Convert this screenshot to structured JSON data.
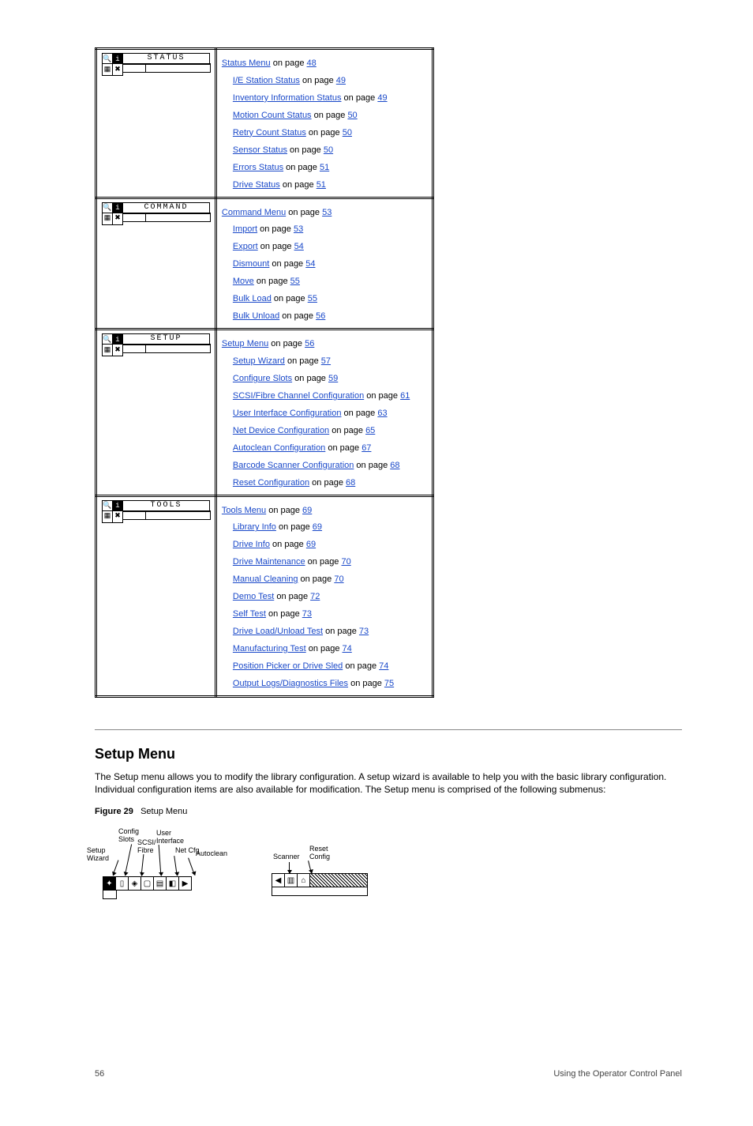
{
  "menu_table": [
    {
      "panel_title": "STATUS",
      "heading": {
        "label": "Status Menu",
        "page": "48"
      },
      "items": [
        {
          "label": "I/E Station Status",
          "page": "49"
        },
        {
          "label": "Inventory Information Status",
          "page": "49"
        },
        {
          "label": "Motion Count Status",
          "page": "50"
        },
        {
          "label": "Retry Count Status",
          "page": "50"
        },
        {
          "label": "Sensor Status",
          "page": "50"
        },
        {
          "label": "Errors Status",
          "page": "51"
        },
        {
          "label": "Drive Status",
          "page": "51"
        }
      ]
    },
    {
      "panel_title": "COMMAND",
      "heading": {
        "label": "Command Menu",
        "page": "53"
      },
      "items": [
        {
          "label": "Import",
          "page": "53"
        },
        {
          "label": "Export",
          "page": "54"
        },
        {
          "label": "Dismount",
          "page": "54"
        },
        {
          "label": "Move",
          "page": "55"
        },
        {
          "label": "Bulk Load",
          "page": "55"
        },
        {
          "label": "Bulk Unload",
          "page": "56"
        }
      ]
    },
    {
      "panel_title": "SETUP",
      "heading": {
        "label": "Setup Menu",
        "page": "56"
      },
      "items": [
        {
          "label": "Setup Wizard",
          "page": "57"
        },
        {
          "label": "Configure Slots",
          "page": "59"
        },
        {
          "label": "SCSI/Fibre Channel Configuration",
          "page": "61"
        },
        {
          "label": "User Interface Configuration",
          "page": "63"
        },
        {
          "label": "Net Device Configuration",
          "page": "65"
        },
        {
          "label": "Autoclean Configuration",
          "page": "67"
        },
        {
          "label": "Barcode Scanner Configuration",
          "page": "68"
        },
        {
          "label": "Reset Configuration",
          "page": "68"
        }
      ]
    },
    {
      "panel_title": "TOOLS",
      "heading": {
        "label": "Tools Menu",
        "page": "69"
      },
      "items": [
        {
          "label": "Library Info",
          "page": "69"
        },
        {
          "label": "Drive Info",
          "page": "69"
        },
        {
          "label": "Drive Maintenance",
          "page": "70"
        },
        {
          "label": "Manual Cleaning",
          "page": "70"
        },
        {
          "label": "Demo Test",
          "page": "72"
        },
        {
          "label": "Self Test",
          "page": "73"
        },
        {
          "label": "Drive Load/Unload Test",
          "page": "73"
        },
        {
          "label": "Manufacturing Test",
          "page": "74"
        },
        {
          "label": "Position Picker or Drive Sled",
          "page": "74"
        },
        {
          "label": "Output Logs/Diagnostics Files",
          "page": "75"
        }
      ]
    }
  ],
  "setup_section": {
    "title": "Setup Menu",
    "body": "The Setup menu allows you to modify the library configuration. A setup wizard is available to help you with the basic library configuration. Individual configuration items are also available for modification. The Setup menu is comprised of the following submenus:",
    "figure_num": "Figure 29",
    "figure_caption": "Setup Menu",
    "diagram_left_labels": [
      "Setup",
      "Wizard",
      "Config",
      "Slots",
      "SCSI/",
      "Fibre",
      "User",
      "Interface",
      "Net Cfg",
      "Autoclean"
    ],
    "diagram_right_labels": [
      "Scanner",
      "Reset",
      "Config"
    ]
  },
  "footer": {
    "page": "56",
    "doc": "Using the Operator Control Panel"
  }
}
